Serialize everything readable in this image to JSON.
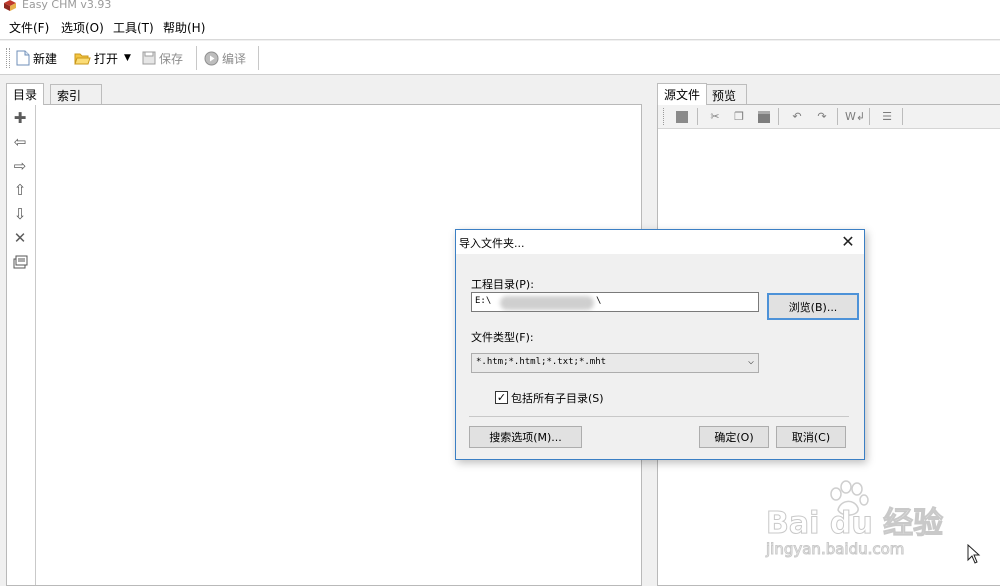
{
  "app": {
    "title": "Easy CHM v3.93",
    "icon": "book-icon"
  },
  "menu": [
    {
      "label": "文件(F)"
    },
    {
      "label": "选项(O)"
    },
    {
      "label": "工具(T)"
    },
    {
      "label": "帮助(H)"
    }
  ],
  "toolbar": {
    "new_label": "新建",
    "open_label": "打开",
    "save_label": "保存",
    "compile_label": "编译"
  },
  "left_panel": {
    "tabs": [
      {
        "label": "目录",
        "active": true
      },
      {
        "label": "索引",
        "active": false
      }
    ],
    "tools": [
      "add-icon",
      "arrow-left-icon",
      "arrow-right-icon",
      "arrow-up-icon",
      "arrow-down-icon",
      "delete-icon",
      "properties-icon"
    ]
  },
  "right_panel": {
    "tabs": [
      {
        "label": "源文件",
        "active": true
      },
      {
        "label": "预览",
        "active": false
      }
    ],
    "tools": [
      "stop-icon",
      "cut-icon",
      "copy-icon",
      "paste-icon",
      "undo-icon",
      "redo-icon",
      "word-wrap-icon",
      "format-icon"
    ]
  },
  "dialog": {
    "title": "导入文件夹...",
    "project_dir_label": "工程目录(P):",
    "project_dir_value_prefix": "E:\\",
    "project_dir_value_suffix": "\\",
    "browse_label": "浏览(B)...",
    "file_type_label": "文件类型(F):",
    "file_type_value": "*.htm;*.html;*.txt;*.mht",
    "include_subdirs_label": "包括所有子目录(S)",
    "include_subdirs_checked": true,
    "search_options_label": "搜索选项(M)...",
    "ok_label": "确定(O)",
    "cancel_label": "取消(C)"
  },
  "watermark": {
    "brand": "Bai du 经验",
    "url": "jingyan.baidu.com"
  },
  "colors": {
    "accent": "#3b7fc4",
    "default_button_border": "#4d92d8",
    "window_bg": "#f0f0f0"
  }
}
